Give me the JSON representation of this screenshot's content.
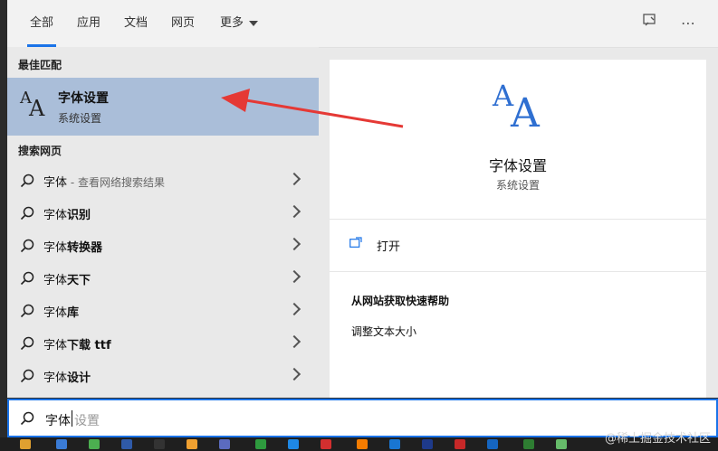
{
  "tabs": [
    {
      "label": "全部",
      "active": true
    },
    {
      "label": "应用"
    },
    {
      "label": "文档"
    },
    {
      "label": "网页"
    },
    {
      "label": "更多"
    }
  ],
  "top_icons": [
    "feedback-icon",
    "more-icon"
  ],
  "best_match": {
    "section_label": "最佳匹配",
    "title": "字体设置",
    "subtitle": "系统设置",
    "icon": "font-aa-icon"
  },
  "web_search": {
    "section_label": "搜索网页",
    "items": [
      {
        "prefix": "字体",
        "bold": "",
        "hint": " - 查看网络搜索结果"
      },
      {
        "prefix": "字体",
        "bold": "识别",
        "hint": ""
      },
      {
        "prefix": "字体",
        "bold": "转换器",
        "hint": ""
      },
      {
        "prefix": "字体",
        "bold": "天下",
        "hint": ""
      },
      {
        "prefix": "字体",
        "bold": "库",
        "hint": ""
      },
      {
        "prefix": "字体",
        "bold": "下载 ttf",
        "hint": ""
      },
      {
        "prefix": "字体",
        "bold": "设计",
        "hint": ""
      }
    ]
  },
  "detail": {
    "title": "字体设置",
    "subtitle": "系统设置",
    "open_label": "打开",
    "help_title": "从网站获取快速帮助",
    "help_link": "调整文本大小"
  },
  "search": {
    "typed": "字体",
    "suggestion": "设置"
  },
  "watermark": "@稀土掘金技术社区",
  "colors": {
    "accent": "#1a73e8",
    "selected_row": "#aabed9",
    "icon_blue": "#2f6fd1",
    "annotation_red": "#e53935"
  }
}
